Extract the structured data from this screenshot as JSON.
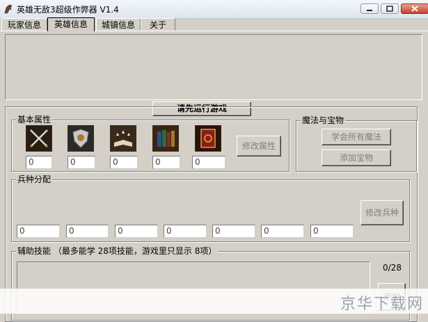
{
  "window": {
    "title": "英雄无敌3超级作弊器 V1.4",
    "minimize_icon": "minimize-icon",
    "maximize_icon": "maximize-icon",
    "close_icon": "close-icon"
  },
  "tabs": [
    {
      "label": "玩家信息",
      "active": false
    },
    {
      "label": "英雄信息",
      "active": true
    },
    {
      "label": "城镇信息",
      "active": false
    },
    {
      "label": "关于",
      "active": false
    }
  ],
  "status_button": "请先运行游戏",
  "basic_attributes": {
    "label": "基本属性",
    "icons": [
      "attack-swords-icon",
      "defense-shield-icon",
      "spell-power-book-icon",
      "knowledge-books-icon",
      "spellbook-icon"
    ],
    "values": [
      "0",
      "0",
      "0",
      "0",
      "0"
    ],
    "modify_button": "修改属性"
  },
  "magic_treasure": {
    "label": "魔法与宝物",
    "learn_all_button": "学会所有魔法",
    "add_treasure_button": "添加宝物"
  },
  "troops": {
    "label": "兵种分配",
    "values": [
      "0",
      "0",
      "0",
      "0",
      "0",
      "0",
      "0"
    ],
    "modify_button": "修改兵种"
  },
  "skills": {
    "label": "辅助技能 （最多能学 28项技能，游戏里只显示 8项）",
    "counter": "0/28",
    "add_button": "添加"
  },
  "watermark": "京华下载网",
  "colors": {
    "face": "#d4d0c8",
    "disabled_text": "#808080"
  }
}
